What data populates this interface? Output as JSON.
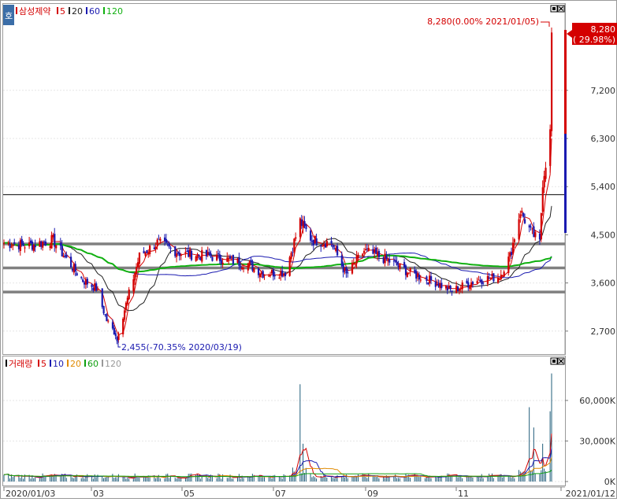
{
  "upper_legend": [
    {
      "label": "삼성제약",
      "color": "#d40000",
      "mark_color": "#d40000"
    },
    {
      "label": "5",
      "color": "#d40000",
      "mark_color": "#d40000"
    },
    {
      "label": "20",
      "color": "#222222",
      "mark_color": "#222222"
    },
    {
      "label": "60",
      "color": "#1a1ab0",
      "mark_color": "#1a1ab0"
    },
    {
      "label": "120",
      "color": "#10b010",
      "mark_color": "#10b010"
    }
  ],
  "lower_legend": [
    {
      "label": "거래량",
      "color": "#d40000",
      "mark_color": "#000000"
    },
    {
      "label": "5",
      "color": "#d40000",
      "mark_color": "#d40000"
    },
    {
      "label": "10",
      "color": "#1a1ab0",
      "mark_color": "#1a1ab0"
    },
    {
      "label": "20",
      "color": "#e08a00",
      "mark_color": "#e08a00"
    },
    {
      "label": "60",
      "color": "#10a010",
      "mark_color": "#10a010"
    },
    {
      "label": "120",
      "color": "#999999",
      "mark_color": "#999999"
    }
  ],
  "side_button_label": "호",
  "high_annotation": "8,280(0.00% 2021/01/05)",
  "low_annotation": "2,455(-70.35% 2020/03/19)",
  "current_price": {
    "price": "8,280",
    "change": "( 29.98%)"
  },
  "price_axis_ticks": [
    "7,200",
    "6,300",
    "5,400",
    "4,500",
    "3,600",
    "2,700"
  ],
  "volume_axis_ticks": [
    "60,000K",
    "30,000K",
    "0K"
  ],
  "date_labels": [
    "2020/01/03",
    "03",
    "05",
    "07",
    "09",
    "11",
    "2021/01/12"
  ],
  "colors": {
    "up": "#d40000",
    "down": "#1a1ab0",
    "ma5": "#d40000",
    "ma20": "#222222",
    "ma60": "#1a1ab0",
    "ma120": "#10b010",
    "support_lines": "#808080"
  },
  "chart_data": {
    "type": "candlestick",
    "title": "삼성제약",
    "x_range": [
      "2020/01/03",
      "2021/01/12"
    ],
    "price_ylim": [
      2300,
      8800
    ],
    "horizontal_lines": [
      5250,
      4330,
      3880,
      3430
    ],
    "price_keypoints": [
      [
        "2020/01/03",
        4350
      ],
      [
        "2020/01/20",
        4300
      ],
      [
        "2020/02/05",
        4400
      ],
      [
        "2020/02/15",
        4000
      ],
      [
        "2020/02/25",
        3650
      ],
      [
        "2020/03/05",
        3500
      ],
      [
        "2020/03/12",
        2900
      ],
      [
        "2020/03/19",
        2600
      ],
      [
        "2020/03/27",
        3400
      ],
      [
        "2020/04/03",
        4100
      ],
      [
        "2020/04/15",
        4350
      ],
      [
        "2020/05/01",
        4150
      ],
      [
        "2020/05/20",
        4100
      ],
      [
        "2020/06/15",
        3950
      ],
      [
        "2020/06/25",
        3780
      ],
      [
        "2020/07/10",
        3800
      ],
      [
        "2020/07/20",
        4750
      ],
      [
        "2020/07/28",
        4400
      ],
      [
        "2020/08/10",
        4350
      ],
      [
        "2020/08/20",
        3750
      ],
      [
        "2020/09/01",
        4200
      ],
      [
        "2020/09/15",
        4050
      ],
      [
        "2020/10/01",
        3800
      ],
      [
        "2020/10/20",
        3600
      ],
      [
        "2020/10/30",
        3450
      ],
      [
        "2020/11/15",
        3650
      ],
      [
        "2020/12/01",
        3720
      ],
      [
        "2020/12/08",
        4100
      ],
      [
        "2020/12/15",
        4950
      ],
      [
        "2020/12/22",
        4550
      ],
      [
        "2020/12/28",
        4350
      ],
      [
        "2020/12/30",
        5500
      ],
      [
        "2021/01/04",
        6400
      ],
      [
        "2021/01/05",
        8280
      ]
    ],
    "high": {
      "value": 8280,
      "date": "2021/01/05",
      "change_pct": 0.0
    },
    "low": {
      "value": 2455,
      "date": "2020/03/19",
      "change_pct": -70.35
    },
    "last": {
      "value": 8280,
      "change_pct": 29.98
    },
    "moving_averages": [
      {
        "name": "5",
        "color": "#d40000"
      },
      {
        "name": "20",
        "color": "#222222"
      },
      {
        "name": "60",
        "color": "#1a1ab0"
      },
      {
        "name": "120",
        "color": "#10b010"
      }
    ],
    "volume": {
      "unit": "K",
      "ylim": [
        0,
        85000
      ],
      "spikes": [
        [
          "2020/07/20",
          72000
        ],
        [
          "2020/07/22",
          28000
        ],
        [
          "2020/08/01",
          12000
        ],
        [
          "2020/12/21",
          55000
        ],
        [
          "2020/12/24",
          40000
        ],
        [
          "2020/12/30",
          28000
        ],
        [
          "2021/01/04",
          52000
        ],
        [
          "2021/01/05",
          80000
        ]
      ]
    }
  }
}
